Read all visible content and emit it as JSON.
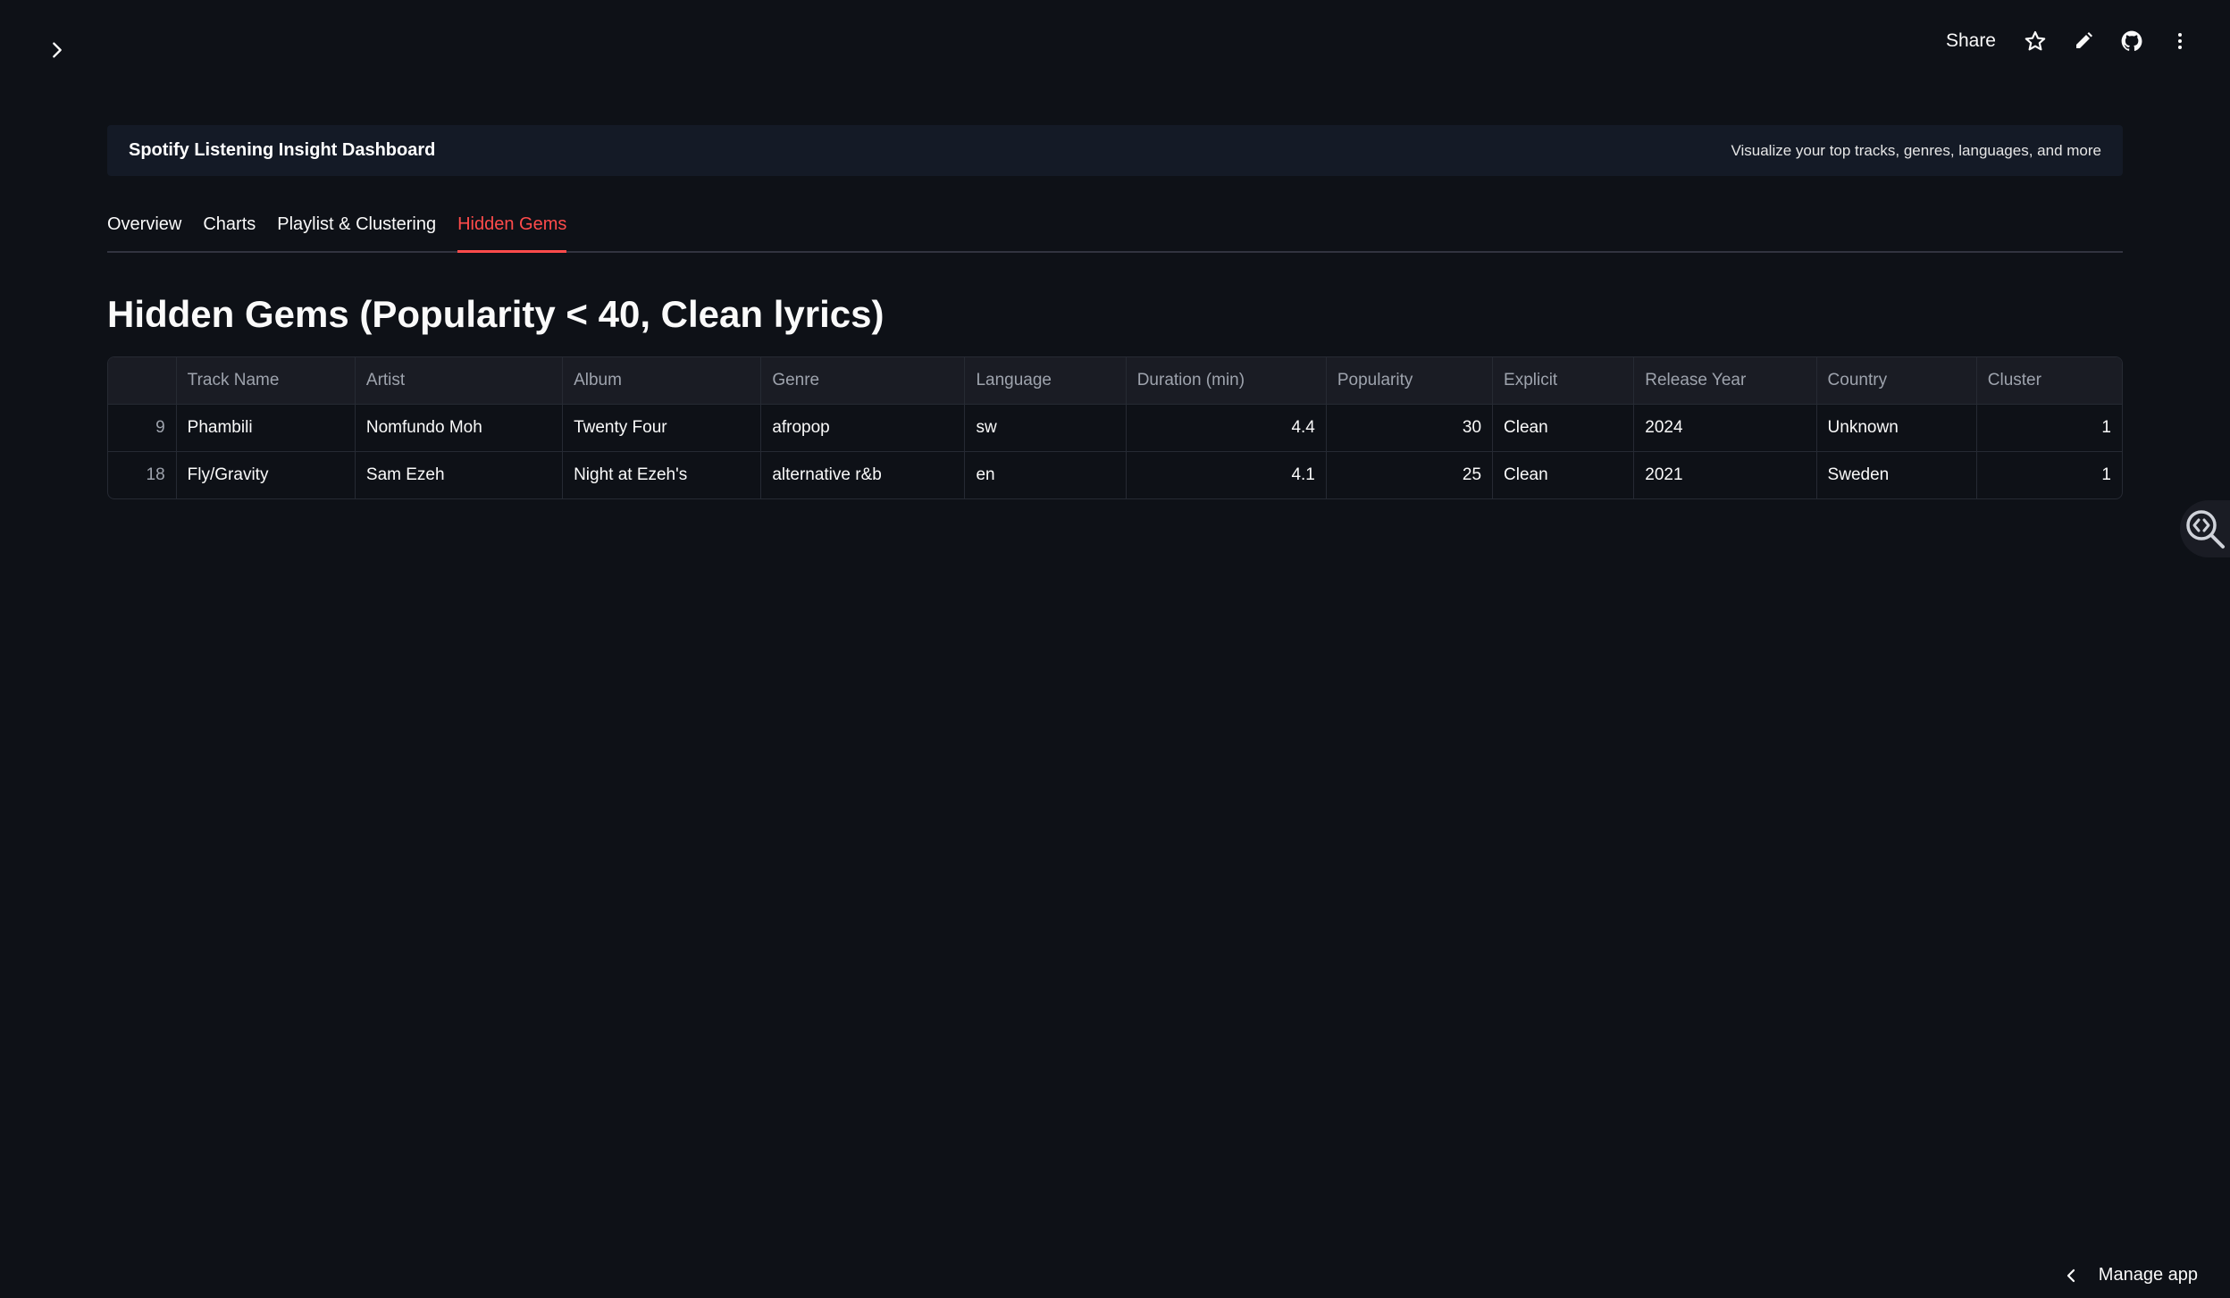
{
  "icons": {
    "sidebar_toggle": "chevron-right-icon",
    "star": "star-icon",
    "edit": "pencil-icon",
    "github": "github-icon",
    "more": "more-vertical-icon",
    "viewer": "code-search-icon",
    "manage_chevron": "chevron-left-icon"
  },
  "colors": {
    "background": "#0e1117",
    "accent": "#ff4b4b",
    "banner_bg": "#141a26"
  },
  "toolbar": {
    "share_label": "Share"
  },
  "banner": {
    "title": "Spotify Listening Insight Dashboard",
    "subtitle": "Visualize your top tracks, genres, languages, and more"
  },
  "tabs": [
    {
      "label": "Overview",
      "active": false
    },
    {
      "label": "Charts",
      "active": false
    },
    {
      "label": "Playlist & Clustering",
      "active": false
    },
    {
      "label": "Hidden Gems",
      "active": true
    }
  ],
  "page_title": "Hidden Gems (Popularity < 40, Clean lyrics)",
  "table": {
    "columns": [
      "",
      "Track Name",
      "Artist",
      "Album",
      "Genre",
      "Language",
      "Duration (min)",
      "Popularity",
      "Explicit",
      "Release Year",
      "Country",
      "Cluster"
    ],
    "rows": [
      [
        "9",
        "Phambili",
        "Nomfundo Moh",
        "Twenty Four",
        "afropop",
        "sw",
        "4.4",
        "30",
        "Clean",
        "2024",
        "Unknown",
        "1"
      ],
      [
        "18",
        "Fly/Gravity",
        "Sam Ezeh",
        "Night at Ezeh's",
        "alternative r&b",
        "en",
        "4.1",
        "25",
        "Clean",
        "2021",
        "Sweden",
        "1"
      ]
    ]
  },
  "footer": {
    "manage_app_label": "Manage app"
  }
}
